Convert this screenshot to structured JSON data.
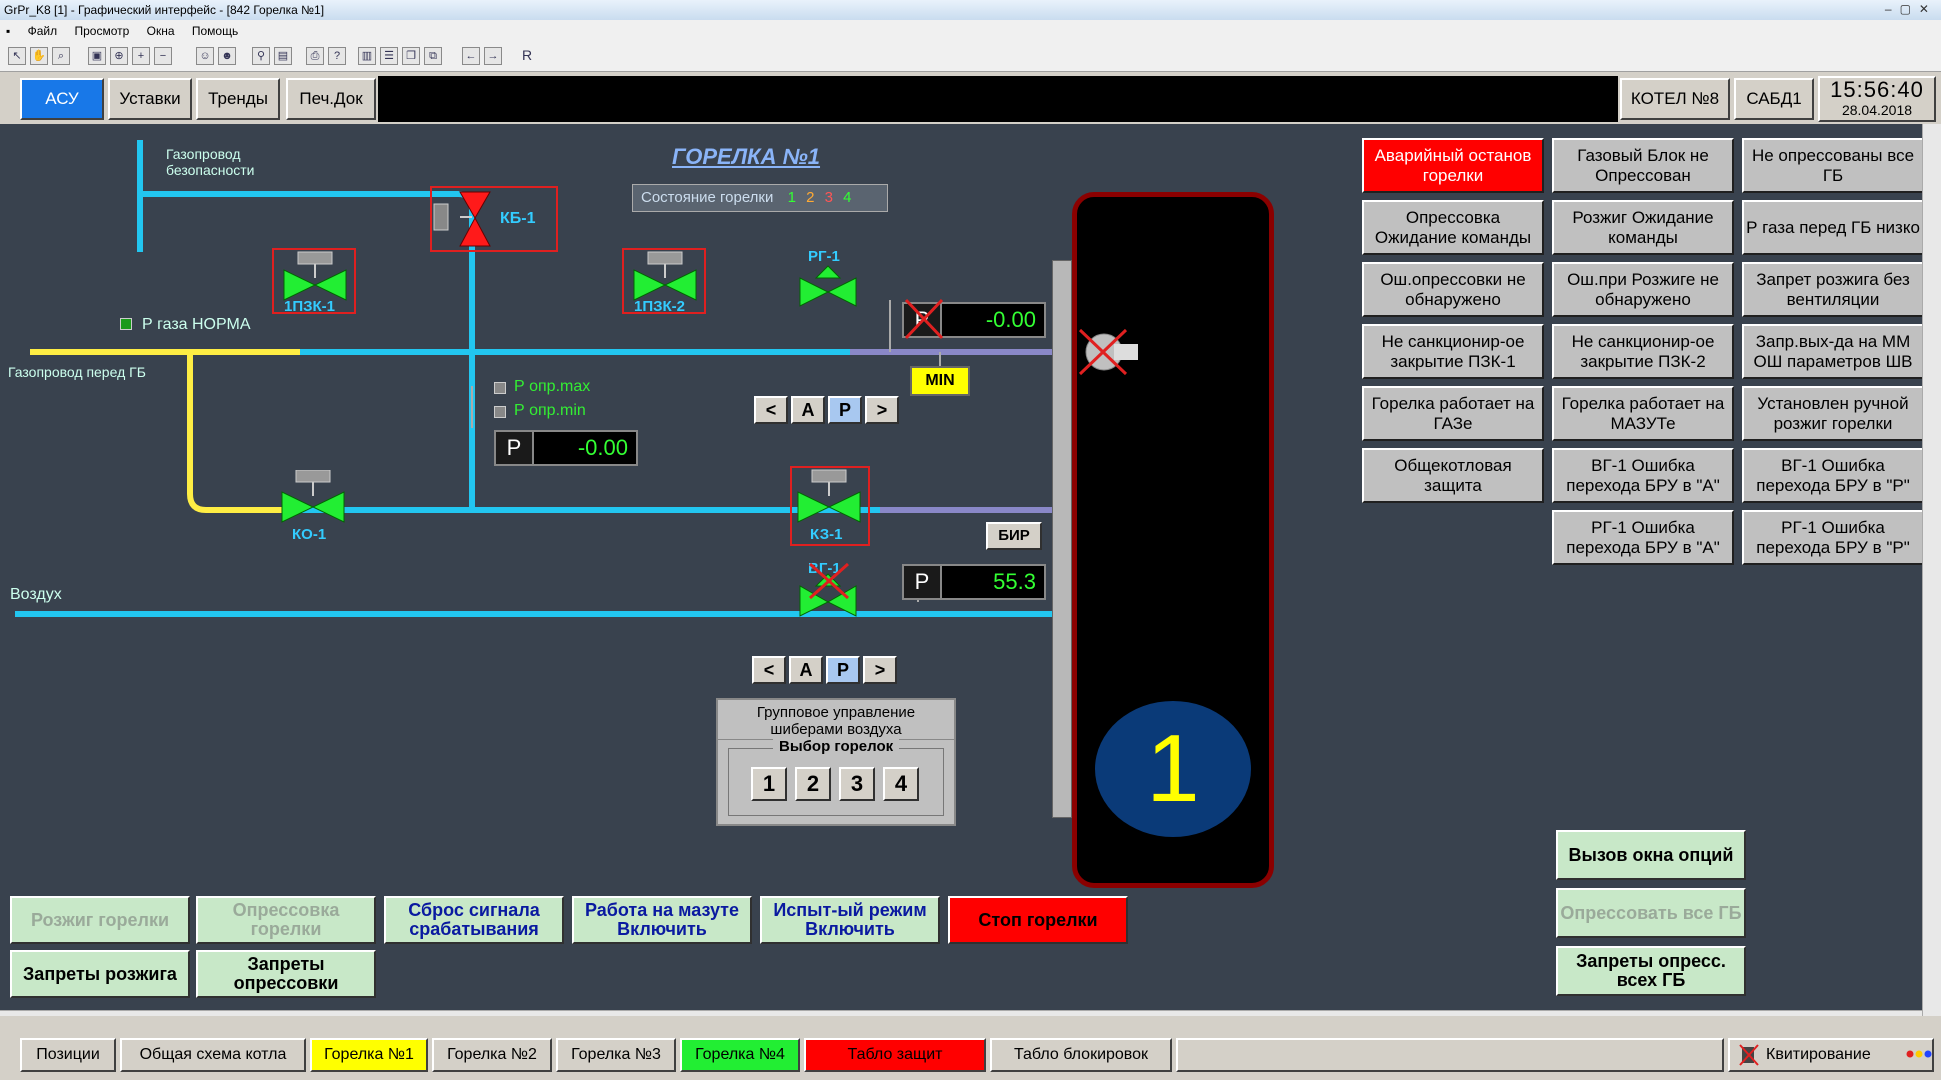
{
  "window": {
    "title": "GrPr_K8 [1] - Графический интерфейс - [842 Горелка №1]"
  },
  "menu": [
    "Файл",
    "Просмотр",
    "Окна",
    "Помощь"
  ],
  "toolbar": {
    "last_label": "R"
  },
  "topnav": {
    "asu": "АСУ",
    "ustavki": "Уставки",
    "trendy": "Тренды",
    "pechdok": "Печ.Док",
    "kotel": "КОТЕЛ №8",
    "sabd": "САБД1",
    "time": "15:56:40",
    "date": "28.04.2018"
  },
  "colors": {
    "background": "#39424e",
    "pipe_gas": "#ffee44",
    "pipe_blue": "#22c6f0",
    "valve_green": "#22ee33",
    "alarm_red": "#ff0000"
  },
  "schematic": {
    "title": "ГОРЕЛКА №1",
    "state_label": "Состояние горелки",
    "state_nums": [
      "1",
      "2",
      "3",
      "4"
    ],
    "gas_safety_line1": "Газопровод",
    "gas_safety_line2": "безопасности",
    "gas_before_gb": "Газопровод перед ГБ",
    "p_gas_norm": "Р газа НОРМА",
    "p_opr_max": "Р опр.max",
    "p_opr_min": "Р опр.min",
    "air": "Воздух",
    "valves": {
      "kb1": "КБ-1",
      "pzk1": "1ПЗК-1",
      "pzk2": "1ПЗК-2",
      "rg1": "РГ-1",
      "ko1": "КО-1",
      "kz1": "КЗ-1",
      "vg1": "ВГ-1"
    },
    "p_label": "Р",
    "p_opr_val": "-0.00",
    "p_rg_val": "-0.00",
    "p_air_val": "55.3",
    "min_label": "MIN",
    "bir_label": "БИР",
    "ctrl_buttons": [
      "<",
      "А",
      "Р",
      ">"
    ],
    "group_title": "Групповое управление шиберами воздуха",
    "group_select": "Выбор горелок",
    "group_nums": [
      "1",
      "2",
      "3",
      "4"
    ],
    "burner_number": "1"
  },
  "status_panel": [
    [
      "Аварийный останов горелки",
      "Газовый Блок не Опрессован",
      "Не опрессованы все ГБ"
    ],
    [
      "Опрессовка Ожидание команды",
      "Розжиг Ожидание команды",
      "Р газа перед ГБ низко"
    ],
    [
      "Ош.опрессовки не обнаружено",
      "Ош.при Розжиге не обнаружено",
      "Запрет розжига без вентиляции"
    ],
    [
      "Не санкционир-ое закрытие ПЗК-1",
      "Не санкционир-ое закрытие ПЗК-2",
      "Запр.вых-да на ММ ОШ параметров ШВ"
    ],
    [
      "Горелка работает на ГАЗе",
      "Горелка работает на МАЗУТе",
      "Установлен ручной розжиг горелки"
    ],
    [
      "Общекотловая защита",
      "ВГ-1 Ошибка перехода БРУ в \"А\"",
      "ВГ-1 Ошибка перехода БРУ в \"Р\""
    ],
    [
      "",
      "РГ-1 Ошибка перехода БРУ в \"А\"",
      "РГ-1 Ошибка перехода БРУ в \"Р\""
    ]
  ],
  "right_buttons": {
    "options": "Вызов окна опций",
    "press_all": "Опрессовать все ГБ",
    "bans_press_all": "Запреты опресс. всех ГБ"
  },
  "bottom_buttons": {
    "ignite": "Розжиг горелки",
    "press": "Опрессовка горелки",
    "reset": "Сброс сигнала срабатывания",
    "mazut": "Работа на мазуте Включить",
    "test": "Испыт-ый режим Включить",
    "stop": "Стоп горелки",
    "bans_ignite": "Запреты розжига",
    "bans_press": "Запреты опрессовки"
  },
  "tabs": {
    "positions": "Позиции",
    "overview": "Общая схема котла",
    "b1": "Горелка №1",
    "b2": "Горелка №2",
    "b3": "Горелка №3",
    "b4": "Горелка №4",
    "protections": "Табло защит",
    "locks": "Табло блокировок",
    "ack": "Квитирование"
  }
}
